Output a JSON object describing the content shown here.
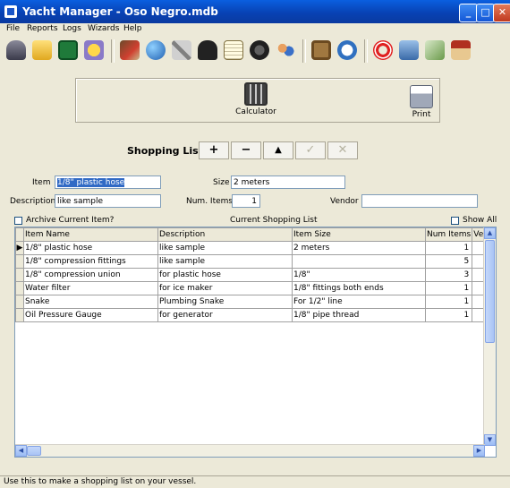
{
  "window": {
    "title": "Yacht Manager - Oso Negro.mdb"
  },
  "menu": [
    "File",
    "Reports",
    "Logs",
    "Wizards",
    "Help"
  ],
  "toolbar_icons": [
    "ship-icon",
    "folder-open-icon",
    "save-icon",
    "star-icon",
    "chart-icon",
    "globe-icon",
    "tools-icon",
    "anchor-icon",
    "notepad-icon",
    "engine-icon",
    "crew-icon",
    "clipboard-icon",
    "clock-icon",
    "life-ring-icon",
    "database-icon",
    "money-icon",
    "house-icon"
  ],
  "panel": {
    "calculator_label": "Calculator",
    "print_label": "Print"
  },
  "shopping": {
    "title": "Shopping List",
    "add": "+",
    "remove": "−",
    "up": "▲",
    "confirm": "✓",
    "cancel": "✕"
  },
  "form": {
    "item_label": "Item",
    "item_value": "1/8\" plastic hose",
    "size_label": "Size",
    "size_value": "2 meters",
    "description_label": "Description",
    "description_value": "like sample",
    "num_items_label": "Num. Items",
    "num_items_value": "1",
    "vendor_label": "Vendor",
    "vendor_value": "",
    "archive_label": "Archive Current Item?",
    "current_list_label": "Current Shopping List",
    "show_all_label": "Show All"
  },
  "table": {
    "columns": [
      "Item Name",
      "Description",
      "Item Size",
      "Num Items",
      "Ve"
    ],
    "rows": [
      [
        "1/8\" plastic hose",
        "like sample",
        "2 meters",
        "1"
      ],
      [
        "1/8\" compression fittings",
        "like sample",
        "",
        "5"
      ],
      [
        "1/8\" compression union",
        "for plastic hose",
        "1/8\"",
        "3"
      ],
      [
        "Water filter",
        "for ice maker",
        "1/8\" fittings both ends",
        "1"
      ],
      [
        "Snake",
        "Plumbing Snake",
        "For 1/2\" line",
        "1"
      ],
      [
        "Oil Pressure Gauge",
        "for generator",
        "1/8\" pipe thread",
        "1"
      ]
    ]
  },
  "status": "Use this to make a shopping list on your vessel.",
  "colors": {
    "title_bar": "#0a5fe0",
    "background": "#ece9d8",
    "selection": "#316ac5"
  }
}
